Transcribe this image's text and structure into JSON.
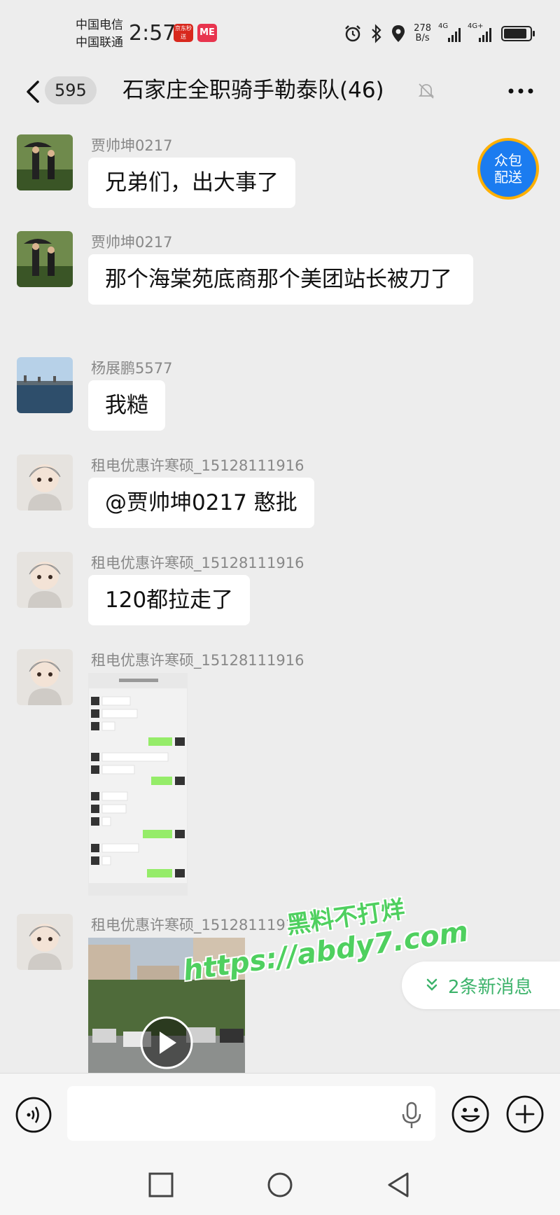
{
  "status_bar": {
    "carrier_1": "中国电信",
    "carrier_2": "中国联通",
    "time": "2:57",
    "app_badges": [
      "京东秒送",
      "ME"
    ],
    "net_speed_value": "278",
    "net_speed_unit": "B/s",
    "signal_1_tag": "4G",
    "signal_2_tag": "4G+"
  },
  "header": {
    "unread_count": "595",
    "title": "石家庄全职骑手勒泰队(46)"
  },
  "delivery_badge": {
    "line1": "众包",
    "line2": "配送"
  },
  "messages": [
    {
      "sender": "贾帅坤0217",
      "text": "兄弟们，出大事了"
    },
    {
      "sender": "贾帅坤0217",
      "text": "那个海棠苑底商那个美团站长被刀了"
    },
    {
      "sender": "杨展鹏5577",
      "text": "我糙"
    },
    {
      "sender": "租电优惠许寒硕_15128111916",
      "text": "@贾帅坤0217  憨批"
    },
    {
      "sender": "租电优惠许寒硕_15128111916",
      "text": "120都拉走了"
    },
    {
      "sender": "租电优惠许寒硕_15128111916",
      "type": "image"
    },
    {
      "sender": "租电优惠许寒硕_15128111916",
      "type": "video"
    }
  ],
  "new_messages": {
    "label": "2条新消息"
  },
  "watermark": {
    "line1": "黑料不打烊",
    "line2": "https://abdy7.com"
  },
  "input": {
    "placeholder": ""
  },
  "colors": {
    "background": "#ededed",
    "accent_green": "#3db36b",
    "badge_blue": "#1b7cf0"
  }
}
